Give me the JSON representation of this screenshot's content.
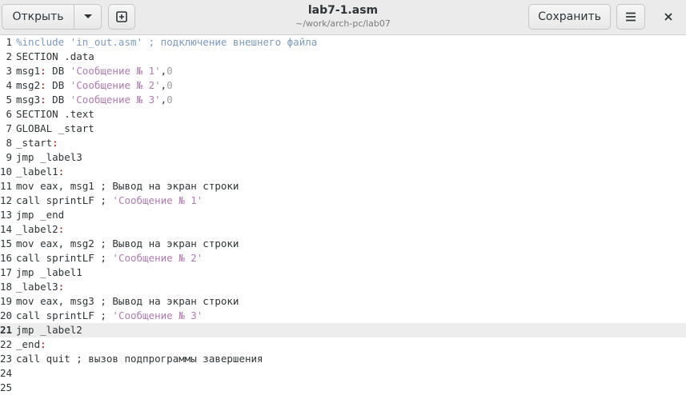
{
  "header": {
    "open_label": "Открыть",
    "save_label": "Сохранить",
    "title": "lab7-1.asm",
    "path": "~/work/arch-pc/lab07"
  },
  "editor": {
    "current_line": 21,
    "lines": [
      {
        "n": "1",
        "parts": [
          [
            "dir",
            "%include 'in_out.asm' ; подключение внешнего файла"
          ]
        ]
      },
      {
        "n": "2",
        "parts": [
          [
            "t",
            "SECTION .data"
          ]
        ]
      },
      {
        "n": "3",
        "parts": [
          [
            "t",
            "msg1"
          ],
          [
            "colon",
            ":"
          ],
          [
            "t",
            " DB "
          ],
          [
            "str",
            "'Сообщение № 1'"
          ],
          [
            "t",
            ","
          ],
          [
            "num",
            "0"
          ]
        ]
      },
      {
        "n": "4",
        "parts": [
          [
            "t",
            "msg2"
          ],
          [
            "colon",
            ":"
          ],
          [
            "t",
            " DB "
          ],
          [
            "str",
            "'Сообщение № 2'"
          ],
          [
            "t",
            ","
          ],
          [
            "num",
            "0"
          ]
        ]
      },
      {
        "n": "5",
        "parts": [
          [
            "t",
            "msg3"
          ],
          [
            "colon",
            ":"
          ],
          [
            "t",
            " DB "
          ],
          [
            "str",
            "'Сообщение № 3'"
          ],
          [
            "t",
            ","
          ],
          [
            "num",
            "0"
          ]
        ]
      },
      {
        "n": "6",
        "parts": [
          [
            "t",
            "SECTION .text"
          ]
        ]
      },
      {
        "n": "7",
        "parts": [
          [
            "t",
            "GLOBAL _start"
          ]
        ]
      },
      {
        "n": "8",
        "parts": [
          [
            "t",
            "_start"
          ],
          [
            "colon",
            ":"
          ]
        ]
      },
      {
        "n": "9",
        "parts": [
          [
            "t",
            "jmp _label3"
          ]
        ]
      },
      {
        "n": "10",
        "parts": [
          [
            "t",
            "_label1"
          ],
          [
            "colon",
            ":"
          ]
        ]
      },
      {
        "n": "11",
        "parts": [
          [
            "t",
            "mov eax, msg1 ; Вывод на экран строки"
          ]
        ]
      },
      {
        "n": "12",
        "parts": [
          [
            "t",
            "call sprintLF ; "
          ],
          [
            "str",
            "'Сообщение № 1'"
          ]
        ]
      },
      {
        "n": "13",
        "parts": [
          [
            "t",
            "jmp _end"
          ]
        ]
      },
      {
        "n": "14",
        "parts": [
          [
            "t",
            "_label2"
          ],
          [
            "colon",
            ":"
          ]
        ]
      },
      {
        "n": "15",
        "parts": [
          [
            "t",
            "mov eax, msg2 ; Вывод на экран строки"
          ]
        ]
      },
      {
        "n": "16",
        "parts": [
          [
            "t",
            "call sprintLF ; "
          ],
          [
            "str",
            "'Сообщение № 2'"
          ]
        ]
      },
      {
        "n": "17",
        "parts": [
          [
            "t",
            "jmp _label1"
          ]
        ]
      },
      {
        "n": "18",
        "parts": [
          [
            "t",
            "_label3"
          ],
          [
            "colon",
            ":"
          ]
        ]
      },
      {
        "n": "19",
        "parts": [
          [
            "t",
            "mov eax, msg3 ; Вывод на экран строки"
          ]
        ]
      },
      {
        "n": "20",
        "parts": [
          [
            "t",
            "call sprintLF ; "
          ],
          [
            "str",
            "'Сообщение № 3'"
          ]
        ]
      },
      {
        "n": "21",
        "parts": [
          [
            "t",
            "jmp _label2"
          ]
        ]
      },
      {
        "n": "22",
        "parts": [
          [
            "t",
            "_end"
          ],
          [
            "colon",
            ":"
          ]
        ]
      },
      {
        "n": "23",
        "parts": [
          [
            "t",
            "call quit ; вызов подпрограммы завершения"
          ]
        ]
      },
      {
        "n": "24",
        "parts": []
      },
      {
        "n": "25",
        "parts": []
      }
    ]
  }
}
